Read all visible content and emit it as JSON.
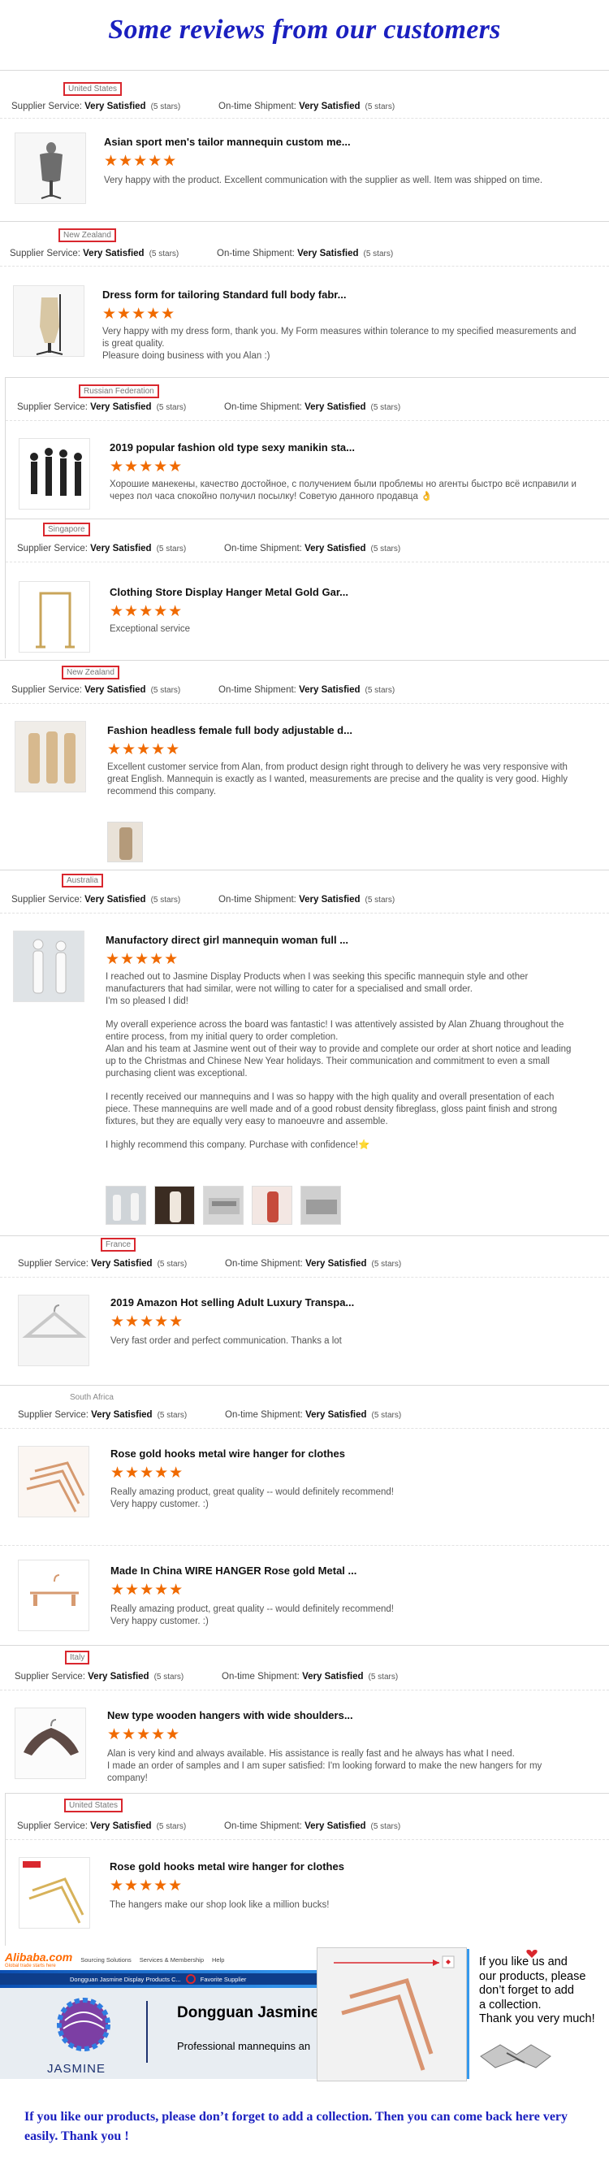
{
  "page_title": "Some reviews from our customers",
  "labels": {
    "supplier_service": "Supplier Service:",
    "on_time_shipment": "On-time Shipment:",
    "very_satisfied": "Very Satisfied",
    "five_stars": "(5 stars)",
    "stars_glyph": "★★★★★"
  },
  "colors": {
    "title_blue": "#1a1fbf",
    "star_orange": "#f06a00",
    "country_border_red": "#d9272e"
  },
  "reviews": [
    {
      "country": "United States",
      "products": [
        {
          "name": "Asian sport men's tailor mannequin custom me...",
          "thumb_icon": "mannequin-torso-icon",
          "comment": [
            "Very happy with the product. Excellent communication with the supplier as well. Item was shipped on time."
          ]
        }
      ]
    },
    {
      "country": "New Zealand",
      "products": [
        {
          "name": "Dress form for tailoring Standard full body fabr...",
          "thumb_icon": "dress-form-icon",
          "comment": [
            "Very happy with my dress form, thank you. My Form measures within tolerance to my specified measurements and is great quality.",
            "Pleasure doing business with you Alan :)"
          ]
        }
      ]
    },
    {
      "country": "Russian Federation",
      "products": [
        {
          "name": "2019 popular fashion old type sexy manikin sta...",
          "thumb_icon": "black-mannequins-icon",
          "comment": [
            "Хорошие манекены, качество достойное, с получением были проблемы но агенты быстро всё исправили и через пол часа спокойно получил посылку! Советую данного продавца 👌"
          ]
        }
      ]
    },
    {
      "country": "Singapore",
      "products": [
        {
          "name": "Clothing Store Display Hanger Metal Gold Gar...",
          "thumb_icon": "garment-rack-icon",
          "comment": [
            "Exceptional service"
          ]
        }
      ]
    },
    {
      "country": "New Zealand",
      "products": [
        {
          "name": "Fashion headless female full body adjustable d...",
          "thumb_icon": "headless-mannequins-icon",
          "comment": [
            "Excellent customer service from Alan, from product design right through to delivery he was very responsive with great English. Mannequin is exactly as I wanted, measurements are precise and the quality is very good. Highly recommend this company."
          ],
          "extra_thumbs": [
            "mannequin-photo-icon"
          ]
        }
      ]
    },
    {
      "country": "Australia",
      "products": [
        {
          "name": "Manufactory direct girl mannequin woman full ...",
          "thumb_icon": "white-mannequins-icon",
          "comment": [
            "I reached out to Jasmine Display Products when I was seeking this specific mannequin style and other manufacturers that had similar, were not willing to cater for a specialised and small order.",
            "I'm so pleased I did!",
            "My overall experience across the board was fantastic! I was attentively assisted by Alan Zhuang throughout the entire process, from my initial query to order completion.",
            "Alan and his team at Jasmine went out of their way to provide and complete our order at short notice and leading up to the Christmas and Chinese New Year holidays. Their communication and commitment to even a small purchasing client was exceptional.",
            "I recently received our mannequins and I was so happy with the high quality and overall presentation of each piece. These mannequins are well made and of a good robust density fibreglass, gloss paint finish and strong fixtures, but they are equally very easy to manoeuvre and assemble.",
            "I highly recommend this company. Purchase with confidence!⭐"
          ],
          "extra_thumbs": [
            "mannequin-photo-icon",
            "mannequin-photo-icon",
            "mannequin-photo-icon",
            "mannequin-photo-icon",
            "mannequin-photo-icon"
          ]
        }
      ]
    },
    {
      "country": "France",
      "products": [
        {
          "name": "2019 Amazon Hot selling Adult Luxury Transpa...",
          "thumb_icon": "clear-hanger-icon",
          "comment": [
            "Very fast order and perfect communication. Thanks a lot"
          ]
        }
      ]
    },
    {
      "country": "South Africa",
      "products": [
        {
          "name": "Rose gold hooks metal wire hanger for clothes",
          "thumb_icon": "rose-gold-hangers-icon",
          "comment": [
            "Really amazing product, great quality -- would definitely recommend!",
            "Very happy customer. :)"
          ]
        },
        {
          "name": "Made In China WIRE HANGER Rose gold Metal ...",
          "thumb_icon": "rose-gold-clip-hanger-icon",
          "comment": [
            "Really amazing product, great quality -- would definitely recommend!",
            "Very happy customer. :)"
          ]
        }
      ]
    },
    {
      "country": "Italy",
      "products": [
        {
          "name": "New type wooden hangers with wide shoulders...",
          "thumb_icon": "wooden-hanger-icon",
          "comment": [
            "Alan is very kind and always available. His assistance is really fast and he always has what I need.",
            "I made an order of samples and I am super satisfied: I'm looking forward to make the new hangers for my company!"
          ]
        }
      ]
    },
    {
      "country": "United States",
      "products": [
        {
          "name": "Rose gold hooks metal wire hanger for clothes",
          "thumb_icon": "gold-hangers-icon",
          "comment": [
            "The hangers make our shop look like a million bucks!"
          ]
        }
      ]
    }
  ],
  "banner": {
    "alibaba_logo": "Alibaba.com",
    "alibaba_sub": "Global trade starts here",
    "nav": [
      "Sourcing Solutions",
      "Services & Membership",
      "Help"
    ],
    "store_bar": "Dongguan Jasmine Display Products C...",
    "favorite_text": "Favorite Supplier",
    "jasmine_logo": "JASMINE",
    "company": "Dongguan Jasmine",
    "tagline": "Professional mannequins an",
    "promo_lines": [
      "If you like us and",
      "our products, please",
      "don’t forget to add",
      "a collection.",
      "Thank you very much!"
    ]
  },
  "footer_message": "If you like our products, please don’t forget to add a collection. Then you can come back here very easily. Thank you !"
}
